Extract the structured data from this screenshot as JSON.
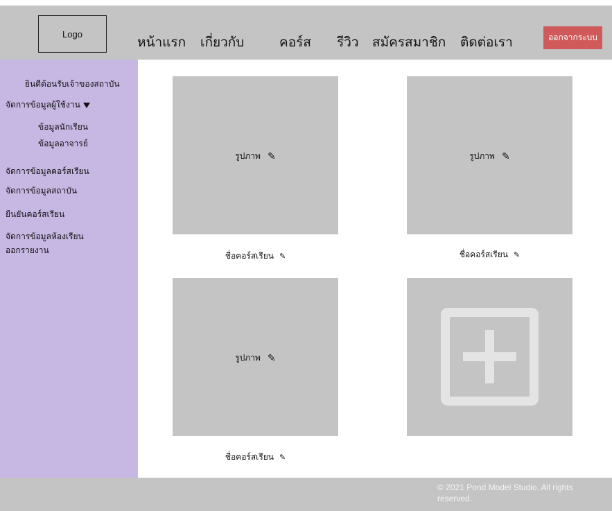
{
  "header": {
    "logo": "Logo",
    "nav": [
      "หน้าแรก",
      "เกี่ยวกับ",
      "คอร์ส",
      "รีวิว",
      "สมัครสมาชิก",
      "ติดต่อเรา"
    ],
    "logout": "ออกจากระบบ"
  },
  "sidebar": {
    "welcome": "ยินดีต้อนรับเจ้าของสถาบัน",
    "manage_users": "จัดการข้อมูลผู้ใช้งาน",
    "students": "ข้อมูลนักเรียน",
    "teachers": "ข้อมูลอาจารย์",
    "manage_courses": "จัดการข้อมูลคอร์สเรียน",
    "manage_institute": "จัดการข้อมูลสถาบัน",
    "confirm_courses": "ยืนยันคอร์สเรียน",
    "manage_classrooms": "จัดการข้อมูลห้องเรียน",
    "reports": "ออกรายงาน"
  },
  "cards": [
    {
      "image_label": "รูปภาพ",
      "name": "ชื่อคอร์สเรียน"
    },
    {
      "image_label": "รูปภาพ",
      "name": "ชื่อคอร์สเรียน"
    },
    {
      "image_label": "รูปภาพ",
      "name": "ชื่อคอร์สเรียน"
    }
  ],
  "icons": {
    "edit": "pencil-icon",
    "add": "add-square-icon",
    "dropdown": "caret-down-icon"
  },
  "colors": {
    "header_bg": "#c4c4c4",
    "sidebar_bg": "#c7b7e3",
    "logout_bg": "#d05a5a",
    "placeholder_bg": "#c4c4c4"
  },
  "footer": {
    "copyright": "© 2021 Pond Model Studio. All rights reserved."
  }
}
